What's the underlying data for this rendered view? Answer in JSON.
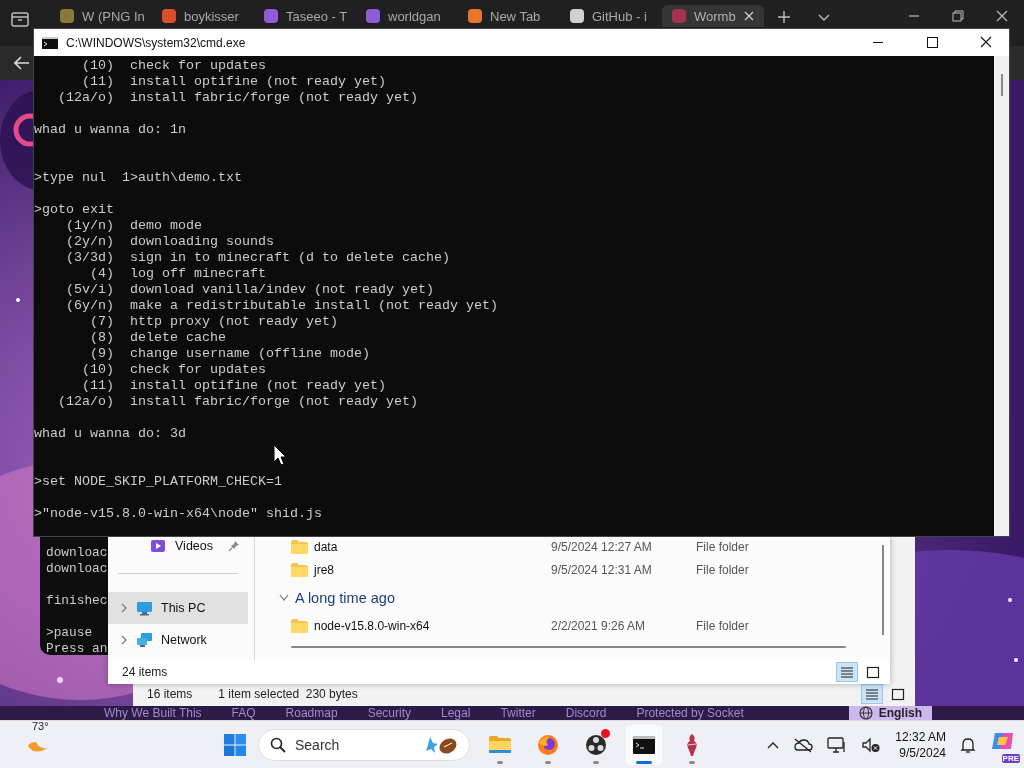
{
  "browser": {
    "tabs": [
      {
        "title": "W (PNG In",
        "color": "#8a7a3a",
        "selected": false
      },
      {
        "title": "boykisser",
        "color": "#d9502a",
        "selected": false
      },
      {
        "title": "Taseeo - T",
        "color": "#8f5bd6",
        "selected": false
      },
      {
        "title": "worldgan",
        "color": "#8f5bd6",
        "selected": false
      },
      {
        "title": "New Tab",
        "color": "#e8762b",
        "selected": false
      },
      {
        "title": "GitHub - i",
        "color": "#d0d0d0",
        "selected": false
      },
      {
        "title": "Wormb",
        "color": "#a3304f",
        "selected": true
      }
    ],
    "footer_links": [
      "Why We Built This",
      "FAQ",
      "Roadmap",
      "Security",
      "Legal",
      "Twitter",
      "Discord",
      "Protected by Socket"
    ],
    "language": "English"
  },
  "background_console": {
    "lines": [
      {
        "kind": "text",
        "text": "downloac"
      },
      {
        "kind": "text",
        "text": "downloac"
      },
      {
        "kind": "blank"
      },
      {
        "kind": "text",
        "text": "finishec"
      },
      {
        "kind": "blank"
      },
      {
        "kind": "text",
        "text": ">pause"
      },
      {
        "kind": "text",
        "text": "Press an"
      }
    ]
  },
  "explorer_back": {
    "item_count": "16 items",
    "selection": "1 item selected  230 bytes",
    "view_buttons": [
      {
        "kind": "details",
        "selected": true
      },
      {
        "kind": "tiles",
        "selected": false
      }
    ]
  },
  "explorer_front": {
    "sidebar": [
      {
        "kind": "videos",
        "label": "Videos",
        "pinned": true,
        "expandable": false,
        "selected": false
      },
      {
        "kind": "separator"
      },
      {
        "kind": "pc",
        "label": "This PC",
        "pinned": false,
        "expandable": true,
        "selected": true
      },
      {
        "kind": "network",
        "label": "Network",
        "pinned": false,
        "expandable": true,
        "selected": false
      }
    ],
    "items": [
      {
        "kind": "folder",
        "name": "data",
        "modified": "9/5/2024 12:27 AM",
        "type": "File folder"
      },
      {
        "kind": "folder",
        "name": "jre8",
        "modified": "9/5/2024 12:31 AM",
        "type": "File folder"
      },
      {
        "kind": "group",
        "label": "A long time ago",
        "expanded": true
      },
      {
        "kind": "folder",
        "name": "node-v15.8.0-win-x64",
        "modified": "2/2/2021 9:26 AM",
        "type": "File folder"
      }
    ],
    "item_count": "24 items",
    "view_buttons": [
      {
        "kind": "details",
        "selected": true
      },
      {
        "kind": "tiles",
        "selected": false
      }
    ]
  },
  "cmd": {
    "title": "C:\\WINDOWS\\system32\\cmd.exe",
    "lines": [
      {
        "kind": "option",
        "key": "(10)",
        "text": "check for updates"
      },
      {
        "kind": "option",
        "key": "(11)",
        "text": "install optifine (not ready yet)"
      },
      {
        "kind": "option",
        "key": "(12a/o)",
        "text": "install fabric/forge (not ready yet)"
      },
      {
        "kind": "blank"
      },
      {
        "kind": "text",
        "text": "whad u wanna do: 1n"
      },
      {
        "kind": "blank"
      },
      {
        "kind": "blank"
      },
      {
        "kind": "text",
        "text": ">type nul  1>auth\\demo.txt"
      },
      {
        "kind": "blank"
      },
      {
        "kind": "text",
        "text": ">goto exit"
      },
      {
        "kind": "option",
        "key": "(1y/n)",
        "text": "demo mode"
      },
      {
        "kind": "option",
        "key": "(2y/n)",
        "text": "downloading sounds"
      },
      {
        "kind": "option",
        "key": "(3/3d)",
        "text": "sign in to minecraft (d to delete cache)"
      },
      {
        "kind": "option",
        "key": "(4)",
        "text": "log off minecraft"
      },
      {
        "kind": "option",
        "key": "(5v/i)",
        "text": "download vanilla/indev (not ready yet)"
      },
      {
        "kind": "option",
        "key": "(6y/n)",
        "text": "make a redistributable install (not ready yet)"
      },
      {
        "kind": "option",
        "key": "(7)",
        "text": "http proxy (not ready yet)"
      },
      {
        "kind": "option",
        "key": "(8)",
        "text": "delete cache"
      },
      {
        "kind": "option",
        "key": "(9)",
        "text": "change username (offline mode)"
      },
      {
        "kind": "option",
        "key": "(10)",
        "text": "check for updates"
      },
      {
        "kind": "option",
        "key": "(11)",
        "text": "install optifine (not ready yet)"
      },
      {
        "kind": "option",
        "key": "(12a/o)",
        "text": "install fabric/forge (not ready yet)"
      },
      {
        "kind": "blank"
      },
      {
        "kind": "text",
        "text": "whad u wanna do: 3d"
      },
      {
        "kind": "blank"
      },
      {
        "kind": "blank"
      },
      {
        "kind": "text",
        "text": ">set NODE_SKIP_PLATFORM_CHECK=1"
      },
      {
        "kind": "blank"
      },
      {
        "kind": "text",
        "text": ">\"node-v15.8.0-win-x64\\node\" shid.js"
      }
    ]
  },
  "taskbar": {
    "temperature": "73°",
    "search": {
      "placeholder": "Search"
    },
    "apps": [
      {
        "kind": "explorer",
        "running": true,
        "active": false,
        "notification": false
      },
      {
        "kind": "firefox",
        "running": true,
        "active": false,
        "notification": false
      },
      {
        "kind": "obs",
        "running": true,
        "active": false,
        "notification": true
      },
      {
        "kind": "terminal",
        "running": true,
        "active": true,
        "notification": false
      },
      {
        "kind": "figure",
        "running": true,
        "active": false,
        "notification": false
      }
    ],
    "time": "12:32 AM",
    "date": "9/5/2024",
    "copilot_badge": "PRE"
  }
}
